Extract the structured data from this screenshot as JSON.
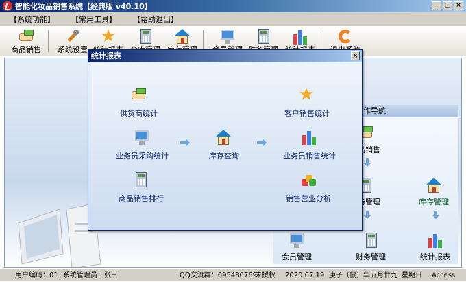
{
  "window": {
    "title": "智能化妆品销售系统【经典版 v40.10】",
    "controls": [
      "_",
      "□",
      "×"
    ]
  },
  "menu": [
    "【系统功能】",
    "【常用工具】",
    "【帮助退出】"
  ],
  "toolbar": [
    {
      "label": "商品销售",
      "icon": "payment-icon"
    },
    {
      "label": "系统设置",
      "icon": "wrench-icon"
    },
    {
      "label": "统计报表",
      "icon": "star-icon"
    },
    {
      "label": "仓库管理",
      "icon": "calculator-icon"
    },
    {
      "label": "库存管理",
      "icon": "warehouse-icon"
    },
    {
      "label": "会员管理",
      "icon": "monitor-icon"
    },
    {
      "label": "财务管理",
      "icon": "calculator-icon"
    },
    {
      "label": "统计报表",
      "icon": "bar-chart-icon"
    },
    {
      "label": "退出系统",
      "icon": "exit-icon"
    }
  ],
  "nav": {
    "header": "操作导航",
    "items": {
      "sales": "商品销售",
      "finance": "财务管理",
      "stock": "库存管理",
      "member": "会员管理",
      "report": "统计报表"
    }
  },
  "dialog": {
    "title": "统计报表",
    "close": "×",
    "items": {
      "supplier_stats": "供货商统计",
      "customer_sales_stats": "客户销售统计",
      "salesman_purchase_stats": "业务员采购统计",
      "inventory_query": "库存查询",
      "salesman_sales_stats": "业务员销售统计",
      "product_sales_rank": "商品销售排行",
      "sales_business_analysis": "销售营业分析"
    }
  },
  "status": {
    "user_code": "用户编码：01",
    "admin": "系统管理员：张三",
    "qq_group": "QQ交流群：695480769",
    "license": "未授权",
    "date": "2020.07.19",
    "lunar": "庚子（鼠）年五月廿九",
    "weekday": "星期日",
    "db": "Access"
  },
  "colors": {
    "title_gradient_start": "#0a246a",
    "title_gradient_end": "#a6caf0",
    "dialog_text": "#102a70"
  }
}
